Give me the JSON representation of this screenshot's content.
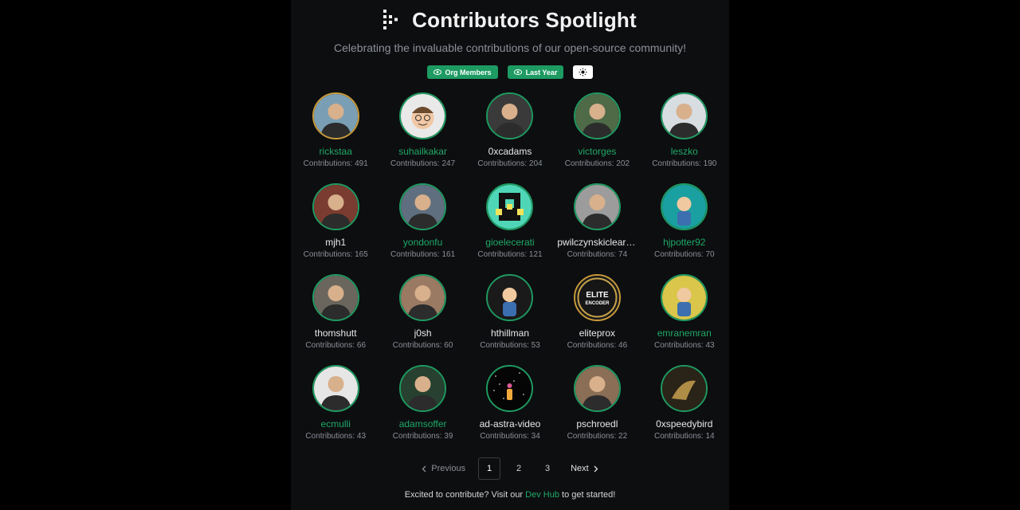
{
  "header": {
    "title": "Contributors Spotlight",
    "subtitle": "Celebrating the invaluable contributions of our open-source community!"
  },
  "filters": {
    "org_members": "Org Members",
    "last_year": "Last Year",
    "theme_icon": "sun-icon"
  },
  "contributors": [
    {
      "name": "rickstaa",
      "count": "Contributions: 491",
      "highlight": true,
      "avatar": "photo",
      "tone": "#7a9fb4"
    },
    {
      "name": "suhailkakar",
      "count": "Contributions: 247",
      "highlight": true,
      "avatar": "memoji",
      "tone": "#e9e9e9"
    },
    {
      "name": "0xcadams",
      "count": "Contributions: 204",
      "highlight": false,
      "avatar": "photo",
      "tone": "#3a3a3a"
    },
    {
      "name": "victorges",
      "count": "Contributions: 202",
      "highlight": true,
      "avatar": "photo",
      "tone": "#4f6a47"
    },
    {
      "name": "leszko",
      "count": "Contributions: 190",
      "highlight": true,
      "avatar": "photo",
      "tone": "#d8dde2"
    },
    {
      "name": "mjh1",
      "count": "Contributions: 165",
      "highlight": false,
      "avatar": "photo",
      "tone": "#7a3c30"
    },
    {
      "name": "yondonfu",
      "count": "Contributions: 161",
      "highlight": true,
      "avatar": "photo",
      "tone": "#5f6f7f"
    },
    {
      "name": "gioelecerati",
      "count": "Contributions: 121",
      "highlight": true,
      "avatar": "identicon",
      "tone": "#4fd6b6"
    },
    {
      "name": "pwilczynskiclearcode",
      "count": "Contributions: 74",
      "highlight": false,
      "avatar": "photo",
      "tone": "#9c9c9c"
    },
    {
      "name": "hjpotter92",
      "count": "Contributions: 70",
      "highlight": true,
      "avatar": "cartoon",
      "tone": "#1aa0a0"
    },
    {
      "name": "thomshutt",
      "count": "Contributions: 66",
      "highlight": false,
      "avatar": "photo",
      "tone": "#6a665d"
    },
    {
      "name": "j0sh",
      "count": "Contributions: 60",
      "highlight": false,
      "avatar": "photo",
      "tone": "#9a7a63"
    },
    {
      "name": "hthillman",
      "count": "Contributions: 53",
      "highlight": false,
      "avatar": "cartoon",
      "tone": "#1a1a1a"
    },
    {
      "name": "eliteprox",
      "count": "Contributions: 46",
      "highlight": false,
      "avatar": "badge",
      "tone": "#1a1a1a",
      "badge_lines": [
        "ELITE",
        "ENCODER"
      ]
    },
    {
      "name": "emranemran",
      "count": "Contributions: 43",
      "highlight": true,
      "avatar": "cartoon",
      "tone": "#d9c64a"
    },
    {
      "name": "ecmulli",
      "count": "Contributions: 43",
      "highlight": true,
      "avatar": "photo",
      "tone": "#e6e6e6"
    },
    {
      "name": "adamsoffer",
      "count": "Contributions: 39",
      "highlight": true,
      "avatar": "photo",
      "tone": "#27402f"
    },
    {
      "name": "ad-astra-video",
      "count": "Contributions: 34",
      "highlight": false,
      "avatar": "space",
      "tone": "#050505"
    },
    {
      "name": "pschroedl",
      "count": "Contributions: 22",
      "highlight": false,
      "avatar": "photo",
      "tone": "#8a6e55"
    },
    {
      "name": "0xspeedybird",
      "count": "Contributions: 14",
      "highlight": false,
      "avatar": "bird",
      "tone": "#2a2418"
    }
  ],
  "pagination": {
    "previous": "Previous",
    "pages": [
      "1",
      "2",
      "3"
    ],
    "current": "1",
    "next": "Next"
  },
  "footer": {
    "text_before": "Excited to contribute? Visit our ",
    "link": "Dev Hub",
    "text_after": " to get started!"
  },
  "colors": {
    "accent": "#1fa866",
    "background": "#0d0e10",
    "muted_text": "#8b8f98"
  }
}
